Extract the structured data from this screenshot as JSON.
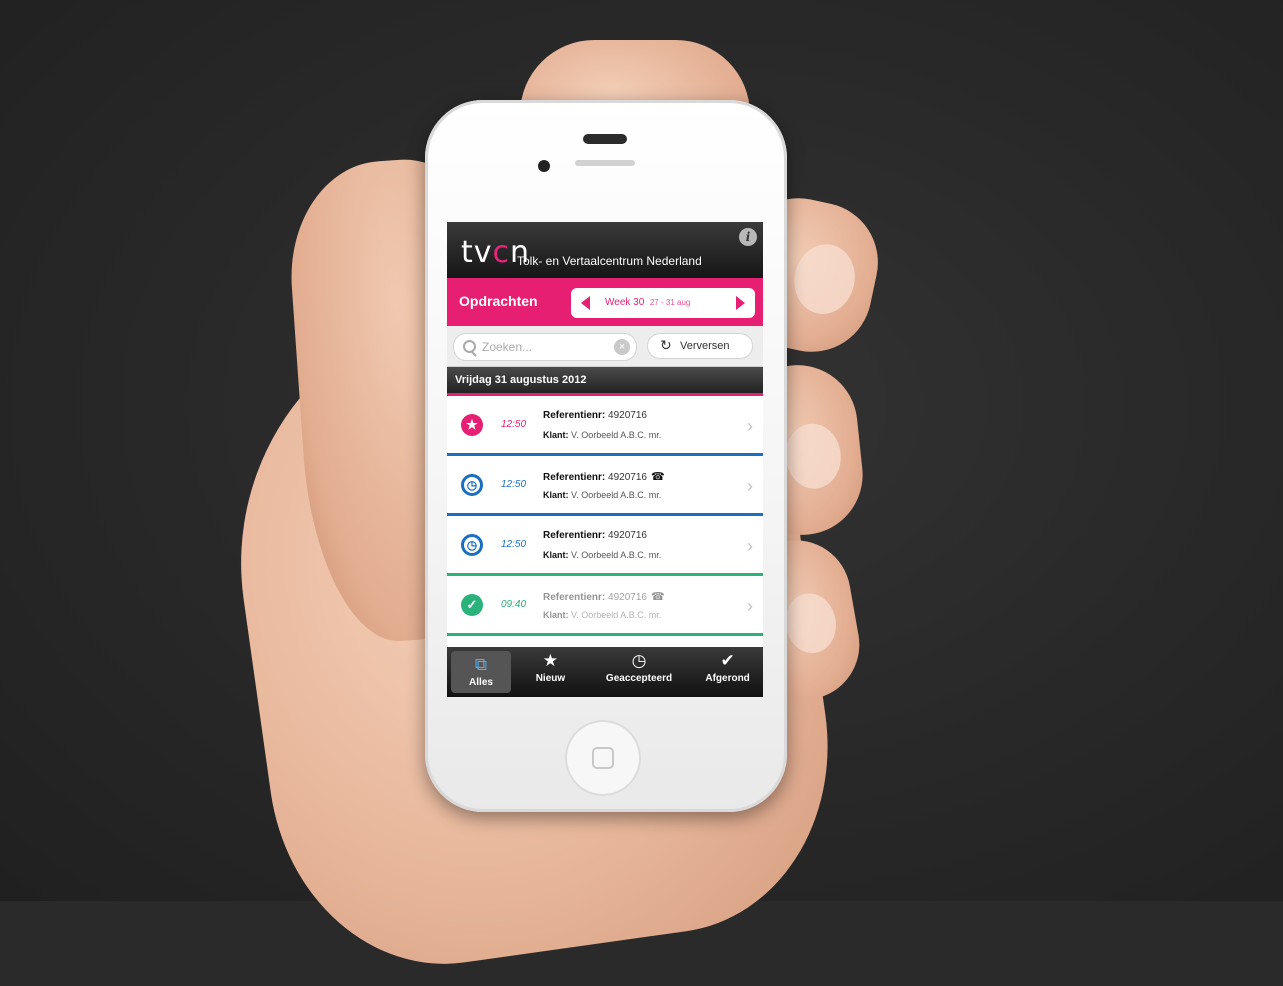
{
  "app": {
    "logo_text_start": "tv",
    "logo_text_accent": "c",
    "logo_text_end": "n",
    "name": "Tolk- en Vertaalcentrum Nederland",
    "info_label": "i"
  },
  "title_bar": {
    "title": "Opdrachten",
    "week_label": "Week 30",
    "week_range": "27 - 31 aug"
  },
  "search": {
    "placeholder": "Zoeken...",
    "refresh_label": "Verversen"
  },
  "list": {
    "date_header": "Vrijdag 31 augustus 2012",
    "items": [
      {
        "status": "new",
        "time": "12:50",
        "ref_label": "Referentienr:",
        "ref_value": "4920716",
        "client_label": "Klant:",
        "client_value": "V. Oorbeeld A.B.C. mr.",
        "phone": false
      },
      {
        "status": "accepted",
        "time": "12:50",
        "ref_label": "Referentienr:",
        "ref_value": "4920716",
        "client_label": "Klant:",
        "client_value": "V. Oorbeeld A.B.C. mr.",
        "phone": true
      },
      {
        "status": "accepted",
        "time": "12:50",
        "ref_label": "Referentienr:",
        "ref_value": "4920716",
        "client_label": "Klant:",
        "client_value": "V. Oorbeeld A.B.C. mr.",
        "phone": false
      },
      {
        "status": "done",
        "time": "09:40",
        "ref_label": "Referentienr:",
        "ref_value": "4920716",
        "client_label": "Klant:",
        "client_value": "V. Oorbeeld A.B.C. mr.",
        "phone": true
      }
    ]
  },
  "tabs": [
    {
      "label": "Alles",
      "icon": "overlapping-squares-icon"
    },
    {
      "label": "Nieuw",
      "icon": "star-icon"
    },
    {
      "label": "Geaccepteerd",
      "icon": "clock-icon"
    },
    {
      "label": "Afgerond",
      "icon": "checkmark-icon"
    }
  ],
  "colors": {
    "brand_pink": "#e61f73",
    "accepted_blue": "#1a6fc1",
    "done_green": "#2ab27b"
  }
}
